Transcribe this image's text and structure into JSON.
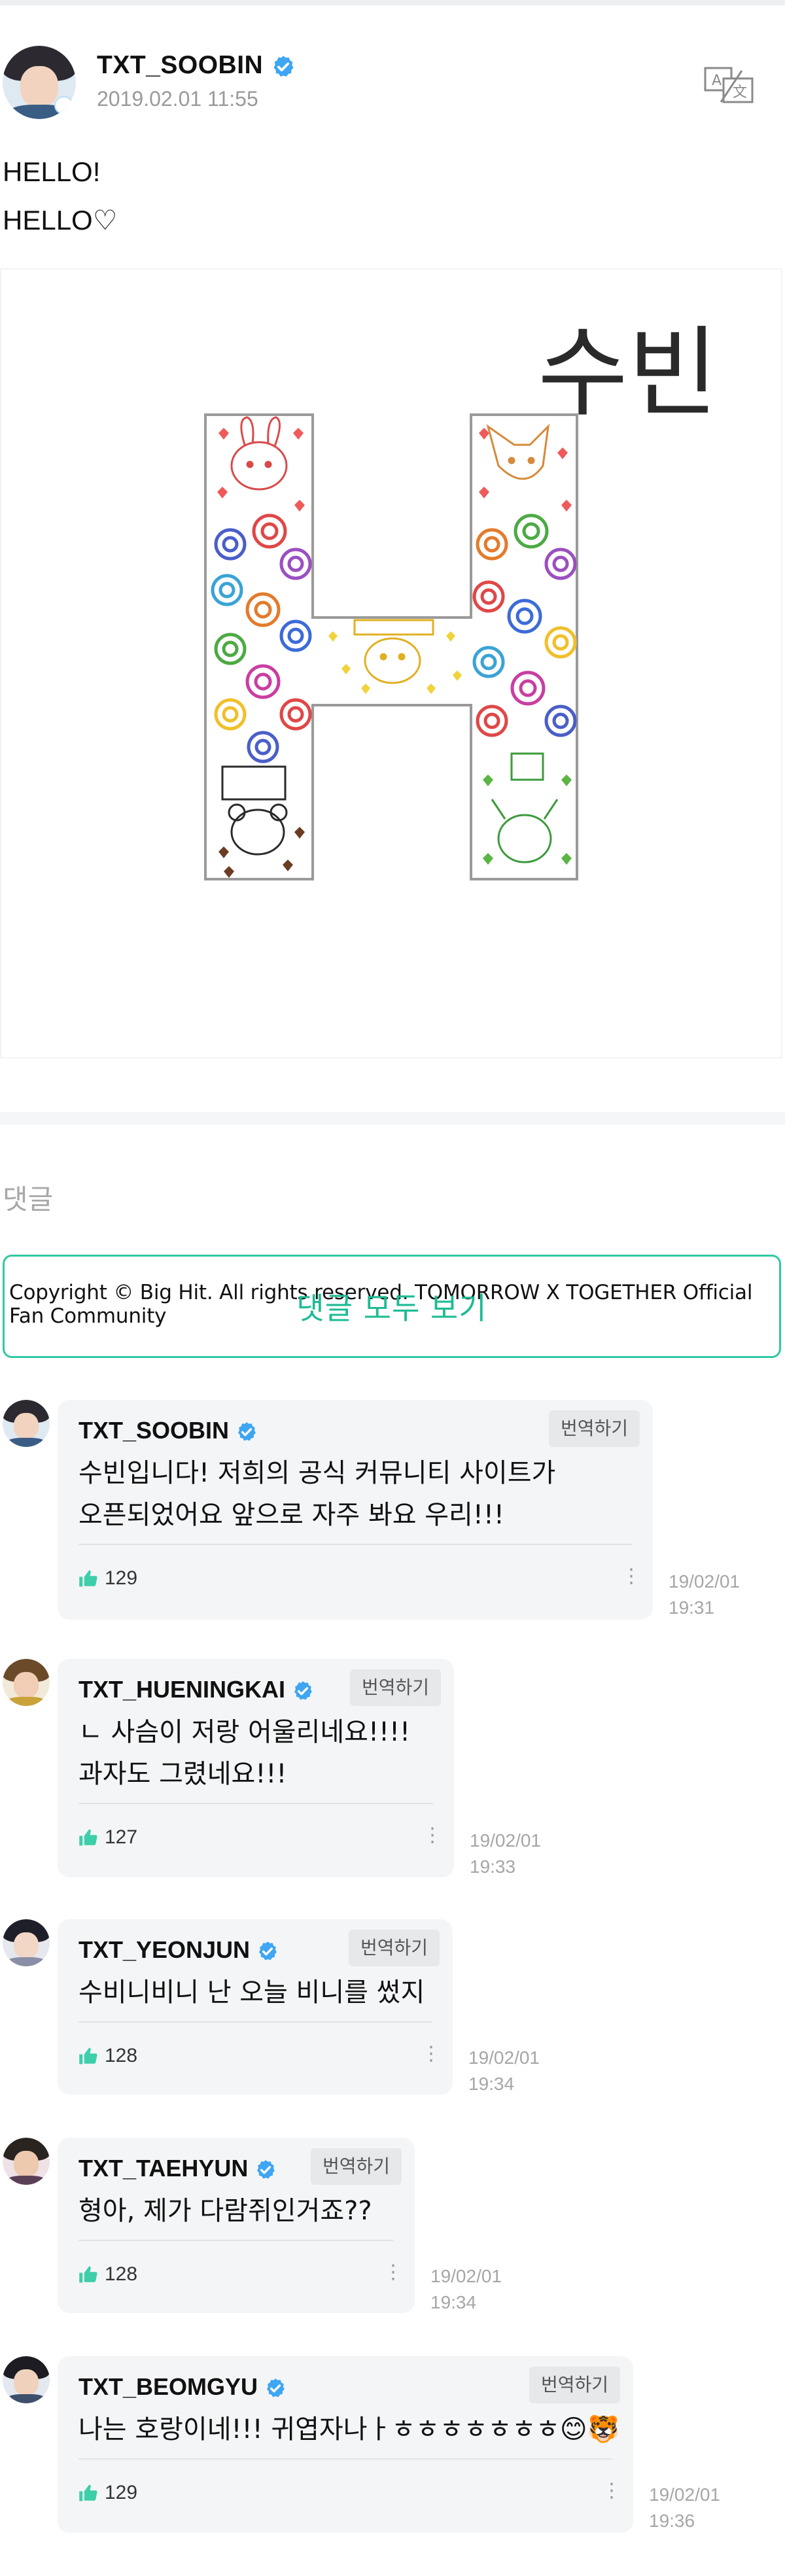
{
  "post": {
    "author": "TXT_SOOBIN",
    "date": "2019.02.01 11:55",
    "lines": [
      "HELLO!",
      "HELLO♡"
    ],
    "image": {
      "handwriting": "수빈",
      "copyright": "Copyright © Big Hit. All rights reserved. TOMORROW X TOGETHER Official Fan Community"
    }
  },
  "comments_section": {
    "label": "댓글",
    "view_all": "댓글 모두 보기"
  },
  "colors": {
    "accent": "#2fc9a4",
    "verified": "#3ea6f2",
    "like": "#3ccfa9"
  },
  "comments": [
    {
      "author": "TXT_SOOBIN",
      "translate": "번역하기",
      "text_lines": [
        "수빈입니다! 저희의 공식 커뮤니티 사이트가",
        "오픈되었어요 앞으로 자주 봐요 우리!!!"
      ],
      "likes": "129",
      "date": "19/02/01",
      "time": "19:31"
    },
    {
      "author": "TXT_HUENINGKAI",
      "translate": "번역하기",
      "text_lines": [
        "ㄴ 사슴이 저랑 어울리네요!!!!",
        "과자도 그렸네요!!!"
      ],
      "likes": "127",
      "date": "19/02/01",
      "time": "19:33"
    },
    {
      "author": "TXT_YEONJUN",
      "translate": "번역하기",
      "text_lines": [
        "수비니비니 난 오늘 비니를 썼지"
      ],
      "likes": "128",
      "date": "19/02/01",
      "time": "19:34"
    },
    {
      "author": "TXT_TAEHYUN",
      "translate": "번역하기",
      "text_lines": [
        "형아, 제가 다람쥐인거죠??"
      ],
      "likes": "128",
      "date": "19/02/01",
      "time": "19:34"
    },
    {
      "author": "TXT_BEOMGYU",
      "translate": "번역하기",
      "text_lines": [
        "나는 호랑이네!!! 귀엽자나ㅏㅎㅎㅎㅎㅎㅎㅎ😊🐯"
      ],
      "likes": "129",
      "date": "19/02/01",
      "time": "19:36"
    }
  ]
}
